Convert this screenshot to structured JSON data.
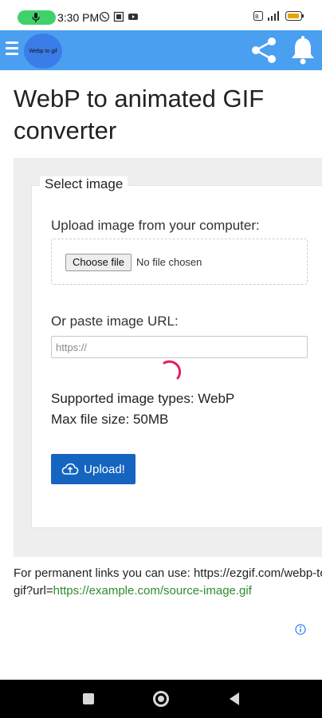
{
  "status_bar": {
    "time": "3:30 PM"
  },
  "header": {
    "logo_text": "Webp to gif"
  },
  "page": {
    "title": "WebP to animated GIF converter"
  },
  "form": {
    "legend": "Select image",
    "upload_label": "Upload image from your computer:",
    "choose_button": "Choose file",
    "no_file_text": "No file chosen",
    "url_label": "Or paste image URL:",
    "url_placeholder": "https://",
    "supported_types": "Supported image types: WebP",
    "max_size": "Max file size: 50MB",
    "upload_button": "Upload!"
  },
  "footer": {
    "permanent_prefix": "For permanent links you can use: https://ezgif.com/webp-to-",
    "permanent_suffix_start": "gif?url=",
    "permanent_example": "https://example.com/source-image.gif"
  },
  "colors": {
    "header_bg": "#4a9ff0",
    "logo_bg": "#3b7de8",
    "upload_button_bg": "#1565c0",
    "spinner": "#e0245e",
    "link_green": "#2e8b2e"
  },
  "icons": {
    "menu": "menu-icon",
    "share": "share-icon",
    "notifications": "bell-icon",
    "upload": "cloud-upload-icon",
    "ad_info": "info-icon"
  }
}
